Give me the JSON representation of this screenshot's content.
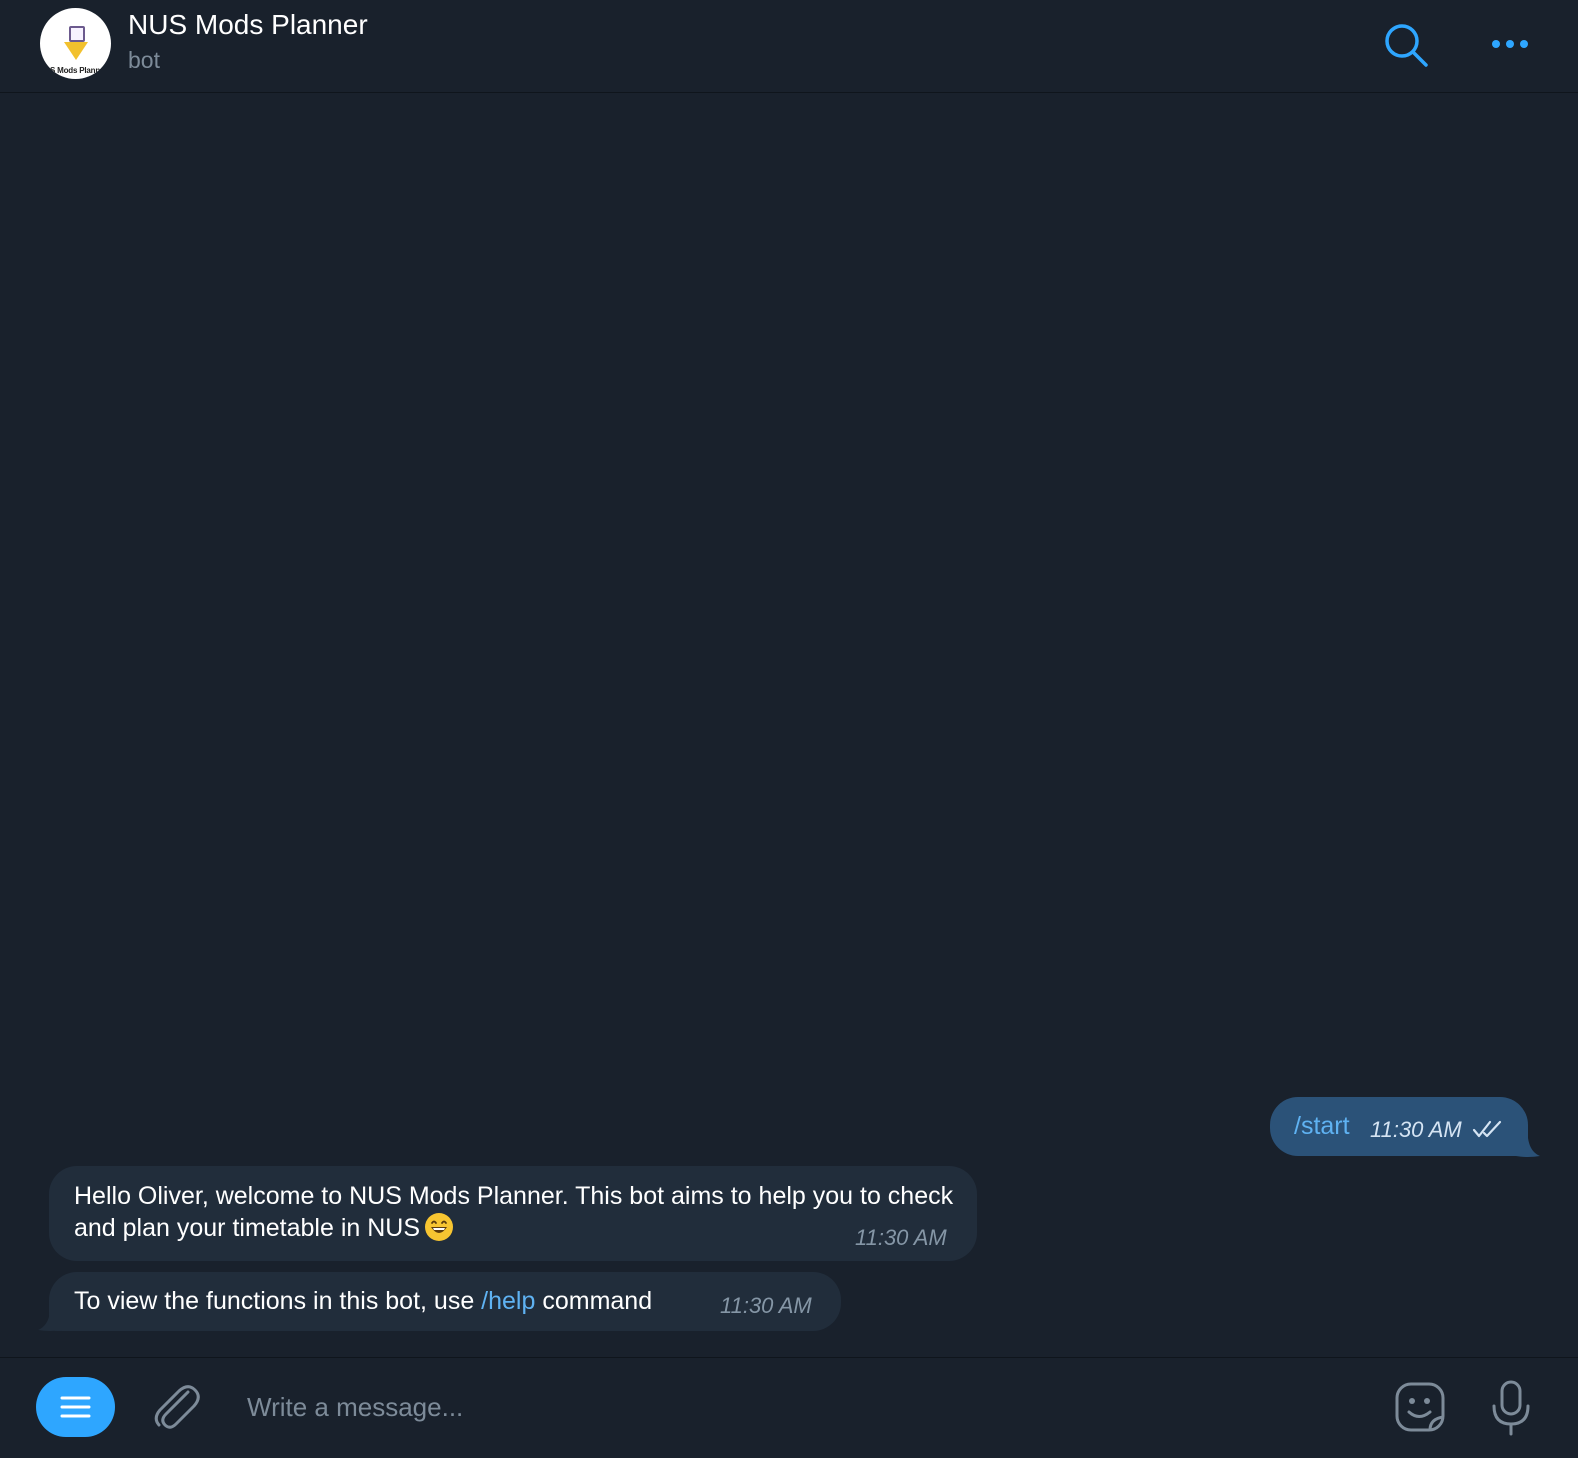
{
  "header": {
    "title": "NUS Mods Planner",
    "subtitle": "bot",
    "avatar_logo_text": "S Mods Plann"
  },
  "messages": [
    {
      "direction": "outgoing",
      "text": "/start",
      "time": "11:30 AM",
      "status": "read"
    },
    {
      "direction": "incoming",
      "text": "Hello Oliver, welcome to NUS Mods Planner. This bot aims to help you to check and plan your timetable in NUS",
      "emoji": "grinning-face-with-smiling-eyes",
      "time": "11:30 AM"
    },
    {
      "direction": "incoming",
      "text_before": "To view the functions in this bot, use ",
      "command": "/help",
      "text_after": " command",
      "time": "11:30 AM"
    }
  ],
  "composer": {
    "placeholder": "Write a message..."
  },
  "colors": {
    "background": "#19212c",
    "accent": "#2ea6ff",
    "outgoing_bubble": "#2b5278",
    "incoming_bubble": "#212d3b",
    "link": "#5fb2f2",
    "muted_text": "#7d8b99"
  },
  "icons": [
    "search-icon",
    "more-icon",
    "menu-icon",
    "paperclip-icon",
    "sticker-icon",
    "microphone-icon",
    "double-check-icon"
  ]
}
